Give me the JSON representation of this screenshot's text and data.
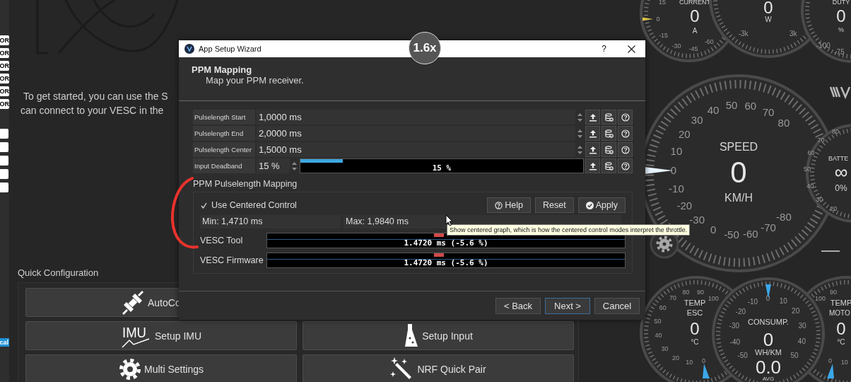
{
  "sidebar": {
    "tags": [
      {
        "text": "OR"
      },
      {
        "text": "OR"
      },
      {
        "text": "OR"
      },
      {
        "text": "OR"
      },
      {
        "text": "OR"
      },
      {
        "text": "OR"
      }
    ],
    "bottom_tag": "cal"
  },
  "intro": [
    "To get started, you can use the S",
    "can connect to your VESC in the"
  ],
  "quick_config": {
    "title": "Quick Configuration",
    "buttons": [
      {
        "label": "AutoCo",
        "kind": "plug"
      },
      {
        "label": "Setup IMU",
        "kind": "imu",
        "icon_text": "IMU"
      },
      {
        "label": "Setup Input",
        "kind": "remote"
      },
      {
        "label": "Multi Settings",
        "kind": "gear"
      },
      {
        "label": "NRF Quick Pair",
        "kind": "wand"
      }
    ]
  },
  "gauges": [
    {
      "kind": "current",
      "readout": [
        {
          "kind": "title",
          "text": "CURRENT"
        },
        {
          "kind": "value",
          "text": "0"
        },
        {
          "kind": "unit",
          "text": "A"
        }
      ],
      "ticks": [
        "15",
        "0",
        "-15",
        "-30",
        "-45",
        "-60"
      ]
    },
    {
      "kind": "power",
      "readout": [
        {
          "kind": "value",
          "text": "0"
        },
        {
          "kind": "unit",
          "text": "W"
        }
      ],
      "ticks": [
        "-3k",
        "3k"
      ]
    },
    {
      "kind": "duty",
      "readout": [
        {
          "kind": "title",
          "text": "DUTY"
        },
        {
          "kind": "value",
          "text": "0"
        },
        {
          "kind": "unit",
          "text": "%"
        }
      ],
      "ticks": [
        "-100",
        "-75"
      ]
    },
    {
      "kind": "speed",
      "readout": [
        {
          "kind": "title",
          "text": "SPEED"
        },
        {
          "kind": "value",
          "text": "0"
        },
        {
          "kind": "unit",
          "text": "KM/H"
        }
      ],
      "ticks": [
        "50",
        "60",
        "40",
        "70",
        "30",
        "80",
        "20",
        "10",
        "0",
        "-10",
        "-20",
        "-80",
        "-30",
        "-70",
        "0",
        "-50",
        "-60"
      ]
    },
    {
      "kind": "battery",
      "readout": [
        {
          "kind": "title",
          "text": "BATTE"
        },
        {
          "kind": "value",
          "text": "∞"
        },
        {
          "kind": "unit",
          "text": "0%"
        }
      ],
      "ticks": [
        "80",
        "70",
        "60",
        "50",
        "40",
        "30",
        "20"
      ]
    },
    {
      "kind": "temp_esc",
      "readout": [
        {
          "kind": "title",
          "text": "TEMP"
        },
        {
          "kind": "title",
          "text": "ESC"
        },
        {
          "kind": "value",
          "text": "0"
        },
        {
          "kind": "unit",
          "text": "°C"
        }
      ],
      "ticks": [
        "100",
        "90",
        "80",
        "70",
        "60",
        "50",
        "40",
        "30",
        "20",
        "10",
        "0"
      ]
    },
    {
      "kind": "consumption",
      "readout": [
        {
          "kind": "title",
          "text": "CONSUMP."
        },
        {
          "kind": "value",
          "text": "0"
        },
        {
          "kind": "unit",
          "text": "WH/KM"
        },
        {
          "kind": "value",
          "text": "0.0"
        },
        {
          "kind": "unit",
          "text": "AVG"
        }
      ],
      "ticks": [
        "-50",
        "-40",
        "-30",
        "-20",
        "-10",
        "0",
        "10",
        "20",
        "30",
        "40",
        "50"
      ]
    },
    {
      "kind": "temp_motor",
      "readout": [
        {
          "kind": "title",
          "text": "TEMP"
        },
        {
          "kind": "title",
          "text": "MOTO"
        },
        {
          "kind": "value",
          "text": "0"
        },
        {
          "kind": "unit",
          "text": "°C"
        }
      ],
      "ticks": [
        "100",
        "90",
        "10",
        "0"
      ]
    }
  ],
  "dialog": {
    "title": "App Setup Wizard",
    "help": "?",
    "heading": "PPM Mapping",
    "subheading": "Map your PPM receiver.",
    "params": [
      {
        "kind": "spin",
        "label": "Pulselength Start",
        "value": "1,0000 ms"
      },
      {
        "kind": "spin",
        "label": "Pulselength End",
        "value": "2,0000 ms"
      },
      {
        "kind": "spin",
        "label": "Pulselength Center",
        "value": "1,5000 ms"
      },
      {
        "kind": "slider",
        "label": "Input Deadband",
        "value": "15 %",
        "level": 0.15,
        "reading": "15 %"
      }
    ],
    "group": {
      "title": "PPM Pulselength Mapping",
      "checkbox": {
        "label": "Use Centered Control",
        "checked": true
      },
      "buttons": [
        {
          "label": "Help",
          "kind": "help"
        },
        {
          "label": "Reset",
          "kind": "plain"
        },
        {
          "label": "Apply",
          "kind": "check"
        }
      ],
      "min": "Min: 1,4710 ms",
      "max": "Max: 1,9840 ms",
      "bars": [
        {
          "label": "VESC Tool",
          "level": 0.48,
          "reading": "1.4720 ms (-5.6 %)"
        },
        {
          "label": "VESC Firmware",
          "level": 0.48,
          "reading": "1.4720 ms (-5.6 %)"
        }
      ]
    },
    "footer": [
      {
        "label": "< Back",
        "focused": false
      },
      {
        "label": "Next >",
        "focused": true
      },
      {
        "label": "Cancel",
        "focused": false
      }
    ]
  },
  "tooltip": "Show centered graph, which is how the centered control modes interpret the throttle.",
  "zoom_indicator": "1.6x"
}
